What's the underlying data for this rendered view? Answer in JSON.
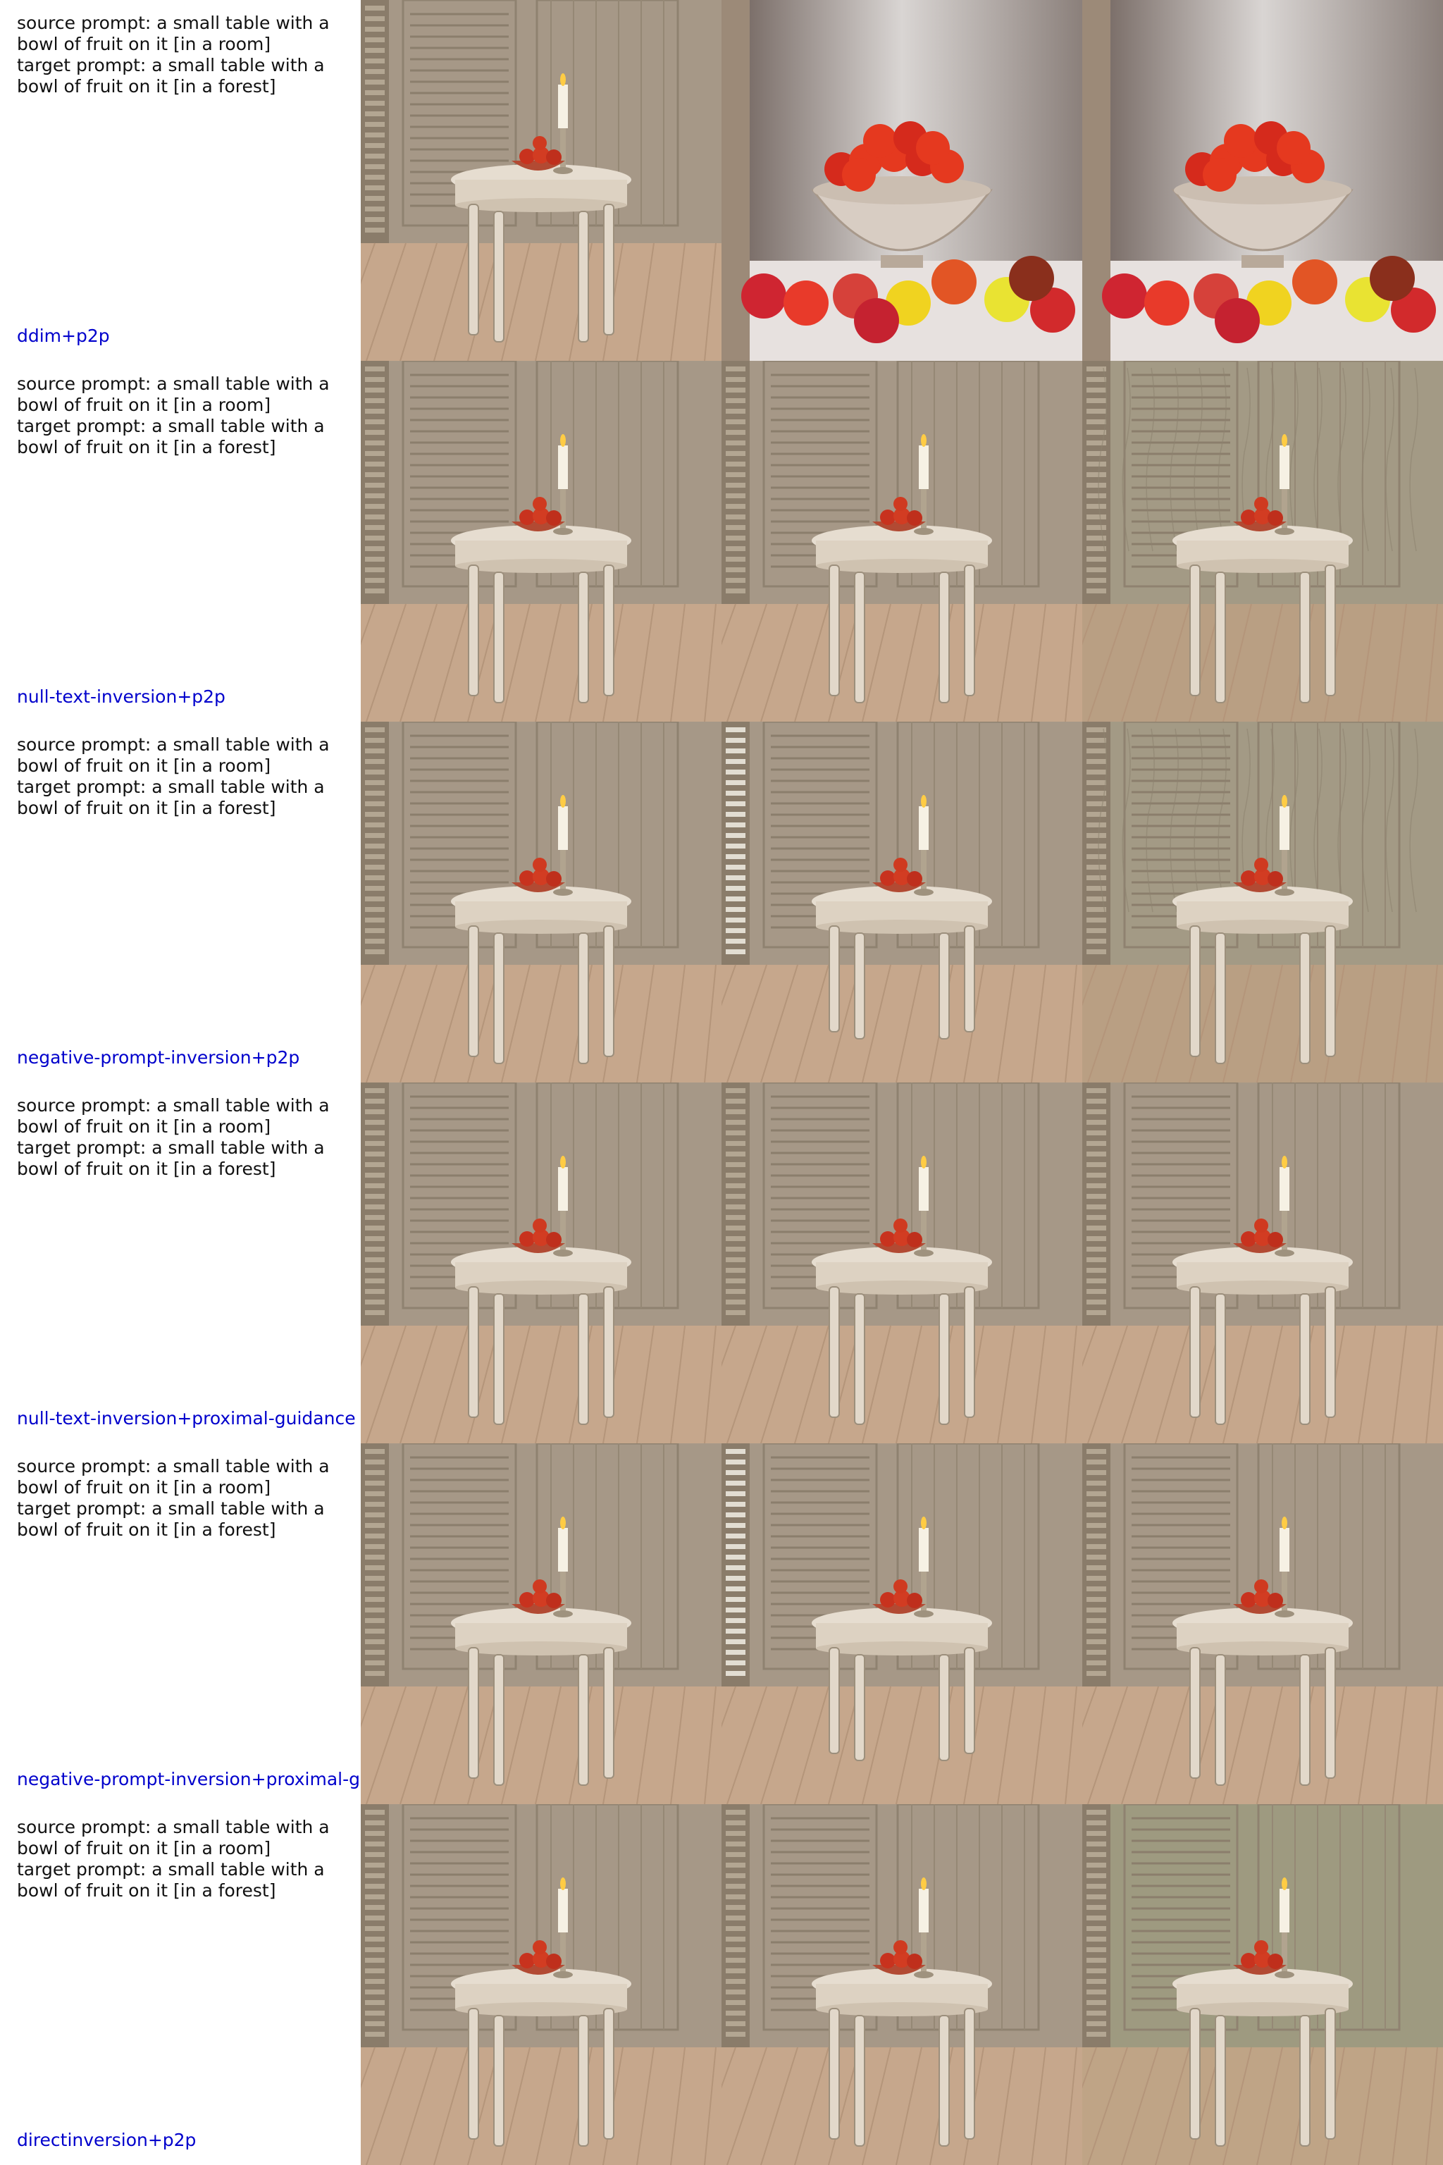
{
  "rows": [
    {
      "method": "ddim+p2p",
      "prompt_lines": [
        "source prompt: a small table with a",
        "bowl of fruit on it [in a room]",
        "target prompt: a small table with a",
        "bowl of fruit on it [in a forest]"
      ],
      "images": [
        "room-scene-source",
        "fruit-bowl-closeup",
        "fruit-bowl-closeup"
      ]
    },
    {
      "method": "null-text-inversion+p2p",
      "prompt_lines": [
        "source prompt: a small table with a",
        "bowl of fruit on it [in a room]",
        "target prompt: a small table with a",
        "bowl of fruit on it [in a forest]"
      ],
      "images": [
        "room-scene-source",
        "room-scene-edit",
        "room-scene-edit-textured"
      ]
    },
    {
      "method": "negative-prompt-inversion+p2p",
      "prompt_lines": [
        "source prompt: a small table with a",
        "bowl of fruit on it [in a room]",
        "target prompt: a small table with a",
        "bowl of fruit on it [in a forest]"
      ],
      "images": [
        "room-scene-source",
        "room-scene-edit-bark",
        "room-scene-edit-textured"
      ]
    },
    {
      "method": "null-text-inversion+proximal-guidance",
      "prompt_lines": [
        "source prompt: a small table with a",
        "bowl of fruit on it [in a room]",
        "target prompt: a small table with a",
        "bowl of fruit on it [in a forest]"
      ],
      "images": [
        "room-scene-source",
        "room-scene-edit",
        "room-scene-edit"
      ]
    },
    {
      "method": "negative-prompt-inversion+proximal-g",
      "prompt_lines": [
        "source prompt: a small table with a",
        "bowl of fruit on it [in a room]",
        "target prompt: a small table with a",
        "bowl of fruit on it [in a forest]"
      ],
      "images": [
        "room-scene-source",
        "room-scene-edit-bark",
        "room-scene-edit"
      ]
    },
    {
      "method": "directinversion+p2p",
      "prompt_lines": [
        "source prompt: a small table with a",
        "bowl of fruit on it [in a room]",
        "target prompt: a small table with a",
        "bowl of fruit on it [in a forest]"
      ],
      "images": [
        "room-scene-source",
        "room-scene-edit",
        "room-scene-edit-green"
      ]
    }
  ]
}
